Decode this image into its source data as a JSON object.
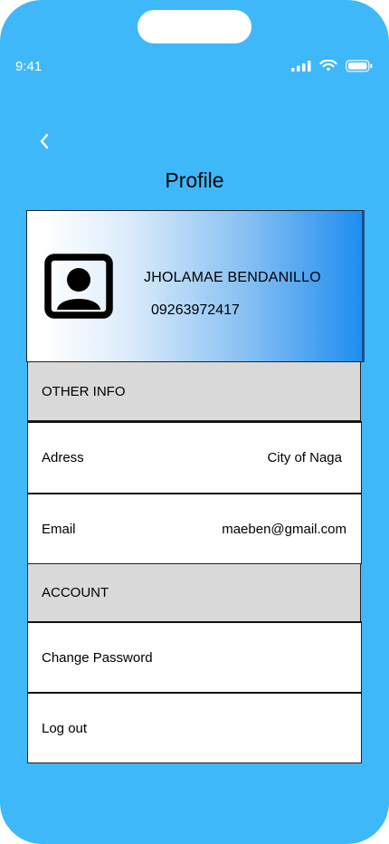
{
  "status_bar": {
    "time": "9:41"
  },
  "header": {
    "title": "Profile"
  },
  "profile": {
    "name": "JHOLAMAE BENDANILLO",
    "phone": "09263972417"
  },
  "sections": {
    "other_info": {
      "title": "OTHER INFO",
      "address": {
        "label": "Adress",
        "value": "City of Naga"
      },
      "email": {
        "label": "Email",
        "value": "maeben@gmail.com"
      }
    },
    "account": {
      "title": "ACCOUNT",
      "change_password": "Change Password",
      "log_out": "Log out"
    }
  },
  "colors": {
    "background": "#3fb8f9",
    "section_header": "#d9d9d9",
    "gradient_end": "#1f8ef0"
  },
  "icons": [
    "cellular-signal-icon",
    "wifi-icon",
    "battery-icon",
    "back-chevron-icon",
    "user-avatar-icon"
  ]
}
